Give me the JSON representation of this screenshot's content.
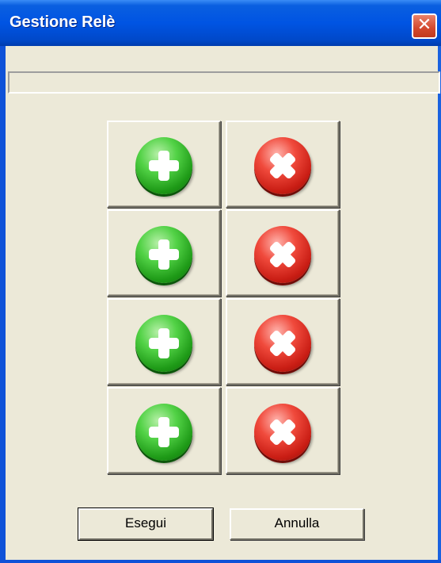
{
  "window": {
    "title": "Gestione Relè",
    "close_glyph": "✕"
  },
  "status_field": {
    "value": ""
  },
  "relays": [
    {
      "on_icon": "plus-green-icon",
      "off_icon": "x-red-icon"
    },
    {
      "on_icon": "plus-green-icon",
      "off_icon": "x-red-icon"
    },
    {
      "on_icon": "plus-green-icon",
      "off_icon": "x-red-icon"
    },
    {
      "on_icon": "plus-green-icon",
      "off_icon": "x-red-icon"
    }
  ],
  "buttons": {
    "execute_label": "Esegui",
    "cancel_label": "Annulla"
  },
  "colors": {
    "titlebar": "#0054e3",
    "on": "#1e9a17",
    "off": "#c91d14",
    "face": "#ece9d8"
  }
}
